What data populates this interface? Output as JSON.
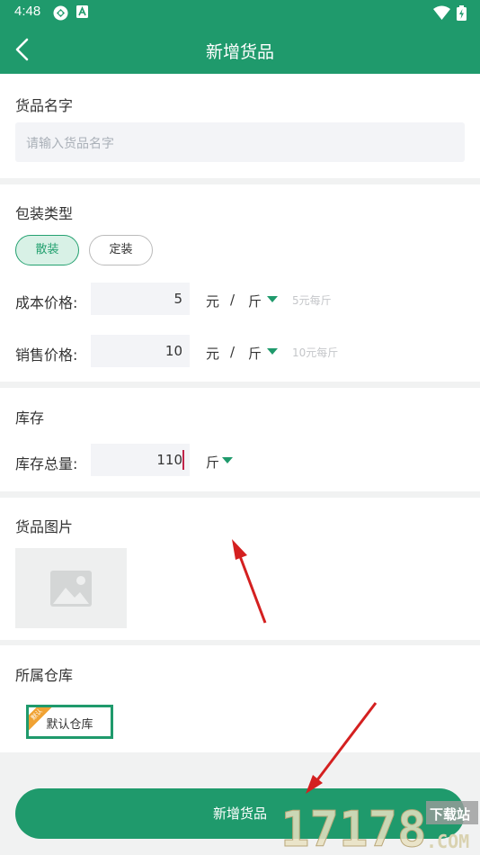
{
  "status_bar": {
    "time": "4:48"
  },
  "app_bar": {
    "title": "新增货品"
  },
  "name_section": {
    "title": "货品名字",
    "placeholder": "请输入货品名字"
  },
  "package_section": {
    "title": "包装类型",
    "options": [
      "散装",
      "定装"
    ],
    "selected": "散装",
    "cost": {
      "label": "成本价格:",
      "value": "5",
      "currency": "元",
      "slash": "/",
      "unit": "斤",
      "hint": "5元每斤"
    },
    "sale": {
      "label": "销售价格:",
      "value": "10",
      "currency": "元",
      "slash": "/",
      "unit": "斤",
      "hint": "10元每斤"
    }
  },
  "stock_section": {
    "title": "库存",
    "total_label": "库存总量:",
    "total_value": "110",
    "unit": "斤"
  },
  "image_section": {
    "title": "货品图片"
  },
  "warehouse_section": {
    "title": "所属仓库",
    "warehouse": "默认仓库",
    "badge": "默认"
  },
  "submit": {
    "label": "新增货品"
  },
  "watermark": {
    "number": "17178",
    "domain": ".COM",
    "tag": "下载站"
  },
  "colors": {
    "primary": "#1f9a6c",
    "selected_bg": "#d8f1e6",
    "input_bg": "#f3f4f7",
    "arrow": "#d42020",
    "badge": "#f0a233"
  }
}
